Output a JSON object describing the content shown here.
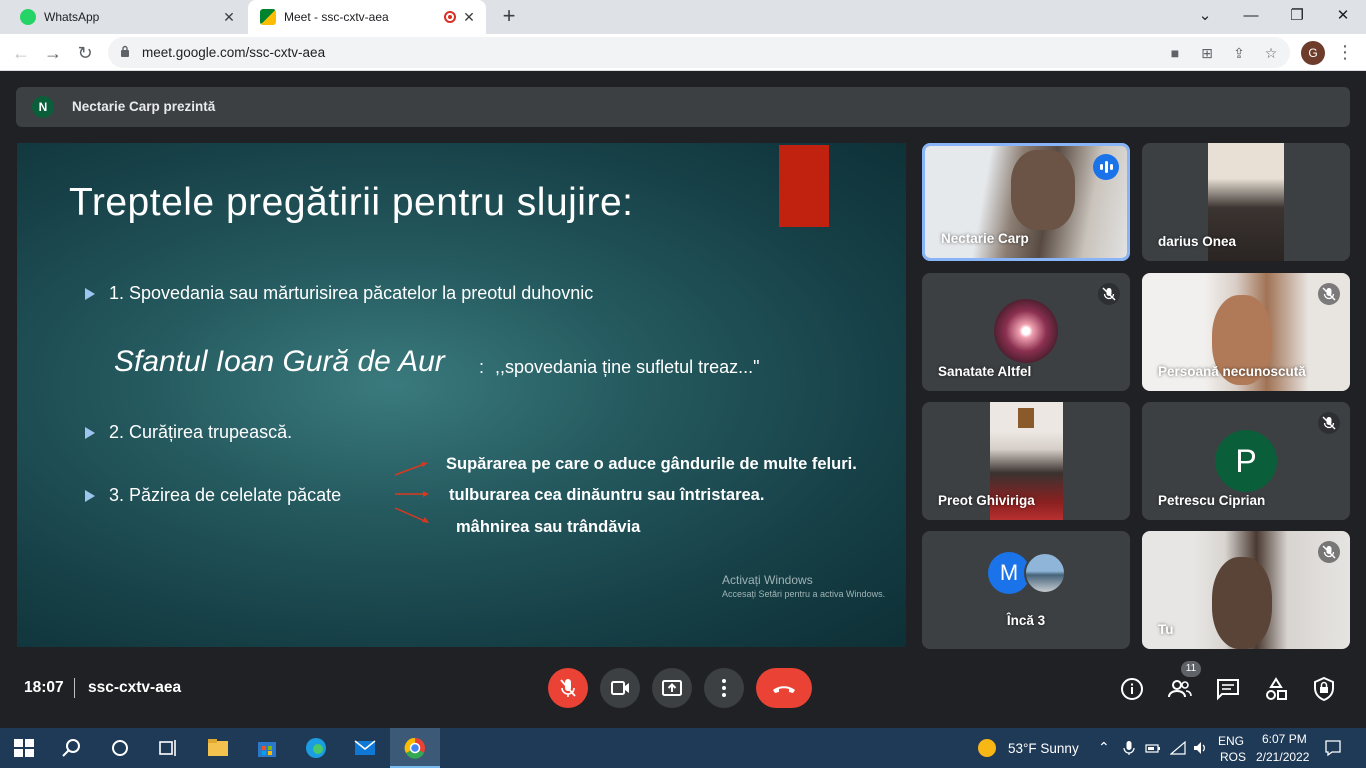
{
  "browser": {
    "tabs": [
      {
        "title": "WhatsApp",
        "active": false
      },
      {
        "title": "Meet - ssc-cxtv-aea",
        "active": true
      }
    ],
    "url": "meet.google.com/ssc-cxtv-aea",
    "profile_initial": "G"
  },
  "meet": {
    "presenting_banner": "Nectarie Carp prezintă",
    "presenter_initial": "N",
    "slide": {
      "title": "Treptele pregătirii pentru slujire:",
      "bullet1": "1. Spovedania sau mărturisirea păcatelor la preotul duhovnic",
      "quote_author": "Sfantul Ioan Gură de Aur",
      "quote_sep": ":",
      "quote_text": ",,spovedania ține sufletul treaz...\"",
      "bullet2": "2. Curățirea trupească.",
      "bullet3": "3. Păzirea de celelate păcate",
      "sub1": "Supărarea pe care o aduce gândurile de multe feluri.",
      "sub2": "tulburarea cea dinăuntru sau întristarea.",
      "sub3": "mâhnirea sau trândăvia",
      "watermark1": "Activați Windows",
      "watermark2": "Accesați Setări pentru a activa Windows."
    },
    "participants": [
      {
        "name": "Nectarie Carp"
      },
      {
        "name": "darius Onea"
      },
      {
        "name": "Sanatate Altfel"
      },
      {
        "name": "Persoană necunoscută"
      },
      {
        "name": "Preot Ghiviriga"
      },
      {
        "name": "Petrescu Ciprian",
        "initial": "P"
      },
      {
        "name": "Încă 3",
        "initial": "M"
      },
      {
        "name": "Tu"
      }
    ],
    "time": "18:07",
    "meeting_code": "ssc-cxtv-aea",
    "people_count": "11"
  },
  "taskbar": {
    "weather": "53°F  Sunny",
    "lang1": "ENG",
    "lang2": "ROS",
    "time": "6:07 PM",
    "date": "2/21/2022"
  },
  "colors": {
    "meet_bg": "#202124",
    "end_call": "#ea4335",
    "speaking_border": "#8ab4f8",
    "slide_red": "#c0220f"
  }
}
